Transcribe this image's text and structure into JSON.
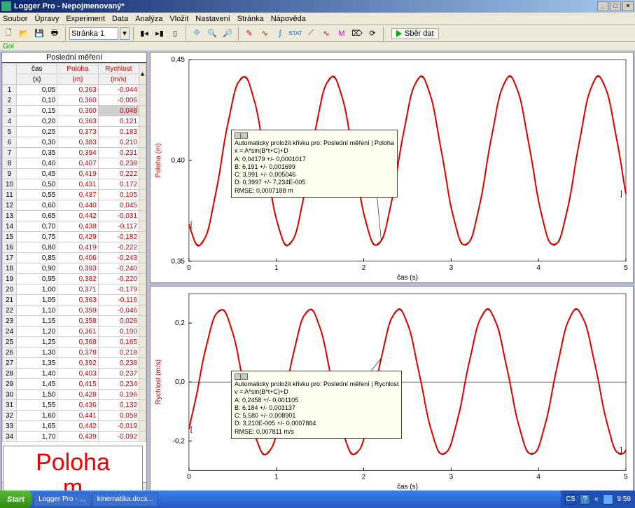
{
  "title": "Logger Pro - Nepojmenovaný*",
  "menubar": [
    "Soubor",
    "Úpravy",
    "Experiment",
    "Data",
    "Analýza",
    "Vložit",
    "Nastavení",
    "Stránka",
    "Nápověda"
  ],
  "page_selector": "Stránka 1",
  "collect_label": "Sběr dat",
  "gol": "Gol",
  "table": {
    "title": "Poslední měření",
    "cols": [
      [
        "čas",
        "(s)"
      ],
      [
        "Poloha",
        "(m)"
      ],
      [
        "Rychlost",
        "(m/s)"
      ]
    ],
    "rows": [
      [
        1,
        "0,05",
        "0,363",
        "-0,044"
      ],
      [
        2,
        "0,10",
        "0,360",
        "-0,006"
      ],
      [
        3,
        "0,15",
        "0,360",
        "0,048"
      ],
      [
        4,
        "0,20",
        "0,363",
        "0,121"
      ],
      [
        5,
        "0,25",
        "0,373",
        "0,183"
      ],
      [
        6,
        "0,30",
        "0,383",
        "0,210"
      ],
      [
        7,
        "0,35",
        "0,394",
        "0,231"
      ],
      [
        8,
        "0,40",
        "0,407",
        "0,238"
      ],
      [
        9,
        "0,45",
        "0,419",
        "0,222"
      ],
      [
        10,
        "0,50",
        "0,431",
        "0,172"
      ],
      [
        11,
        "0,55",
        "0,437",
        "0,105"
      ],
      [
        12,
        "0,60",
        "0,440",
        "0,045"
      ],
      [
        13,
        "0,65",
        "0,442",
        "-0,031"
      ],
      [
        14,
        "0,70",
        "0,438",
        "-0,117"
      ],
      [
        15,
        "0,75",
        "0,429",
        "-0,182"
      ],
      [
        16,
        "0,80",
        "0,419",
        "-0,222"
      ],
      [
        17,
        "0,85",
        "0,406",
        "-0,243"
      ],
      [
        18,
        "0,90",
        "0,393",
        "-0,240"
      ],
      [
        19,
        "0,95",
        "0,382",
        "-0,220"
      ],
      [
        20,
        "1,00",
        "0,371",
        "-0,179"
      ],
      [
        21,
        "1,05",
        "0,363",
        "-0,116"
      ],
      [
        22,
        "1,10",
        "0,359",
        "-0,046"
      ],
      [
        23,
        "1,15",
        "0,358",
        "0,026"
      ],
      [
        24,
        "1,20",
        "0,361",
        "0,100"
      ],
      [
        25,
        "1,25",
        "0,368",
        "0,165"
      ],
      [
        26,
        "1,30",
        "0,378",
        "0,218"
      ],
      [
        27,
        "1,35",
        "0,392",
        "0,238"
      ],
      [
        28,
        "1,40",
        "0,403",
        "0,237"
      ],
      [
        29,
        "1,45",
        "0,415",
        "0,234"
      ],
      [
        30,
        "1,50",
        "0,428",
        "0,196"
      ],
      [
        31,
        "1,55",
        "0,436",
        "0,132"
      ],
      [
        32,
        "1,60",
        "0,441",
        "0,058"
      ],
      [
        33,
        "1,65",
        "0,442",
        "-0,019"
      ],
      [
        34,
        "1,70",
        "0,439",
        "-0,092"
      ]
    ],
    "selected_row": 3
  },
  "badge": {
    "l1": "Poloha",
    "l2": "m"
  },
  "chart_data": [
    {
      "type": "line",
      "title": "",
      "xlabel": "čas (s)",
      "ylabel": "Poloha (m)",
      "xlim": [
        0,
        5
      ],
      "ylim": [
        0.35,
        0.45
      ],
      "yticks": [
        0.35,
        0.4,
        0.45
      ],
      "xticks": [
        0,
        1,
        2,
        3,
        4,
        5
      ],
      "fit": {
        "title": "Automaticky proložit křivku pro: Poslední měření | Poloha",
        "eq": "x = A*sin(B*t+C)+D",
        "A": "0,04179 +/- 0,0001017",
        "B": "6,191 +/- 0,001699",
        "C": "3,991 +/- 0,005046",
        "D": "0,3997 +/- 7,234E-005",
        "rmse": "RMSE: 0,0007188 m"
      },
      "sine": {
        "A": 0.04179,
        "B": 6.191,
        "C": 3.991,
        "D": 0.3997
      }
    },
    {
      "type": "line",
      "title": "",
      "xlabel": "čas (s)",
      "ylabel": "Rychlost (m/s)",
      "xlim": [
        0,
        5
      ],
      "ylim": [
        -0.3,
        0.3
      ],
      "yticks": [
        -0.2,
        0.0,
        0.2
      ],
      "xticks": [
        0,
        1,
        2,
        3,
        4,
        5
      ],
      "fit": {
        "title": "Automaticky proložit křivku pro: Poslední měření | Rychlost",
        "eq": "v = A*sin(B*t+C)+D",
        "A": "0,2458 +/- 0,001105",
        "B": "6,184 +/- 0,003137",
        "C": "5,580 +/- 0,008901",
        "D": "3,210E-005 +/- 0,0007864",
        "rmse": "RMSE: 0,007811 m/s"
      },
      "sine": {
        "A": 0.2458,
        "B": 6.184,
        "C": 5.58,
        "D": 0.0
      }
    }
  ],
  "taskbar": {
    "start": "Start",
    "items": [
      "Logger Pro - ...",
      "kinematika.docx..."
    ],
    "lang": "CS",
    "time": "9:59"
  }
}
